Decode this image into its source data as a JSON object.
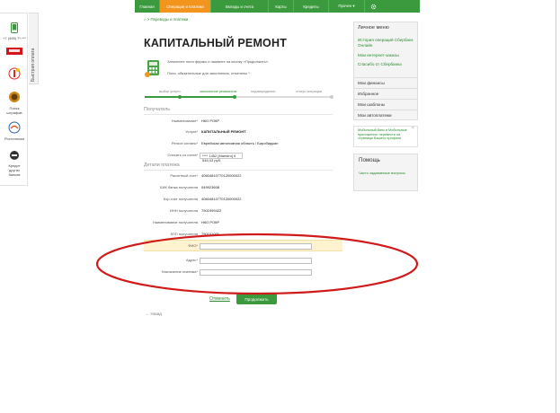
{
  "left_panel": {
    "quick_pay_tab": "Быстрая оплата",
    "items": [
      {
        "label": "+7 (495) 7*-***",
        "icon": "phone-icon"
      },
      {
        "label": "МТС",
        "icon": "mts-logo-icon"
      },
      {
        "label": "",
        "icon": "yandex-icon"
      },
      {
        "label": "Поиск штрафов",
        "icon": "gibdd-emblem-icon"
      },
      {
        "label": "Ростелеком",
        "icon": "rostelecom-icon"
      },
      {
        "label": "Кредит\nдругих банков",
        "icon": "credit-icon"
      }
    ]
  },
  "nav": {
    "items": [
      {
        "label": "Главная",
        "active": false
      },
      {
        "label": "Операции и платежи",
        "active": true
      },
      {
        "label": "Вклады и счета",
        "active": false
      },
      {
        "label": "Карты",
        "active": false
      },
      {
        "label": "Кредиты",
        "active": false
      },
      {
        "label": "Прочее ▾",
        "active": false
      }
    ],
    "settings_icon": "gear-icon"
  },
  "breadcrumb": "⌂ > Переводы и платежи",
  "page_title": "КАПИТАЛЬНЫЙ РЕМОНТ",
  "info": {
    "line1": "Заполните поля формы и нажмите на кнопку «Продолжить».",
    "line2": "Поля, обязательные для заполнения, отмечены *"
  },
  "steps": [
    {
      "label": "выбор услуги",
      "state": "done"
    },
    {
      "label": "заполнение реквизитов",
      "state": "active"
    },
    {
      "label": "подтверждение",
      "state": "pending"
    },
    {
      "label": "статус операции",
      "state": "pending"
    }
  ],
  "form": {
    "recipient_header": "Получатель",
    "recipient": [
      {
        "label": "Наименование",
        "required": true,
        "value": "НКО РОКР"
      },
      {
        "label": "Услуга",
        "required": true,
        "value": "КАПИТАЛЬНЫЙ РЕМОНТ"
      },
      {
        "label": "Регион оплаты",
        "required": true,
        "value": "Еврейская автономная область / Биробиджан"
      },
      {
        "label": "Списать со счета",
        "required": true,
        "value": "**** 1452 [Maestro] 6 546,43   руб."
      }
    ],
    "details_header": "Детали платежа",
    "details": [
      {
        "label": "Расчетный счет",
        "required": true,
        "value": "40604810770120000022"
      },
      {
        "label": "БИК банка получателя",
        "required": false,
        "value": "049923608"
      },
      {
        "label": "Кор.счет получателя",
        "required": false,
        "value": "40604810770120000022"
      },
      {
        "label": "ИНН получателя",
        "required": false,
        "value": "7901999422"
      },
      {
        "label": "Наименование получателя",
        "required": false,
        "value": "НКО РОКР"
      },
      {
        "label": "КПП получателя",
        "required": false,
        "value": "790101001"
      }
    ],
    "inputs": [
      {
        "label": "ФИО",
        "required": true,
        "value": ""
      },
      {
        "label": "Адрес",
        "required": true,
        "value": ""
      },
      {
        "label": "Назначение платежа",
        "required": true,
        "value": ""
      }
    ],
    "cancel_label": "Отменить",
    "continue_label": "Продолжить",
    "back_label": "← Назад"
  },
  "sidebar": {
    "personal_menu_title": "Личное меню",
    "links": [
      "История операций Сбербанк Онлайн",
      "Мои интернет-заказы",
      "Спасибо от Сбербанка"
    ],
    "items": [
      "Мои финансы",
      "Избранное",
      "Мои шаблоны",
      "Мои автоплатежи"
    ],
    "ad_text": "Мобильный банк и Мобильные приложения: перевести на страницы Вашего профиля",
    "help_title": "Помощь",
    "help_link": "Часто задаваемые вопросы"
  },
  "colors": {
    "brand_green": "#3b9a3e",
    "nav_active": "#f3941d",
    "annotation_red": "#d01a1a",
    "highlight_row": "#fdf3d0"
  }
}
